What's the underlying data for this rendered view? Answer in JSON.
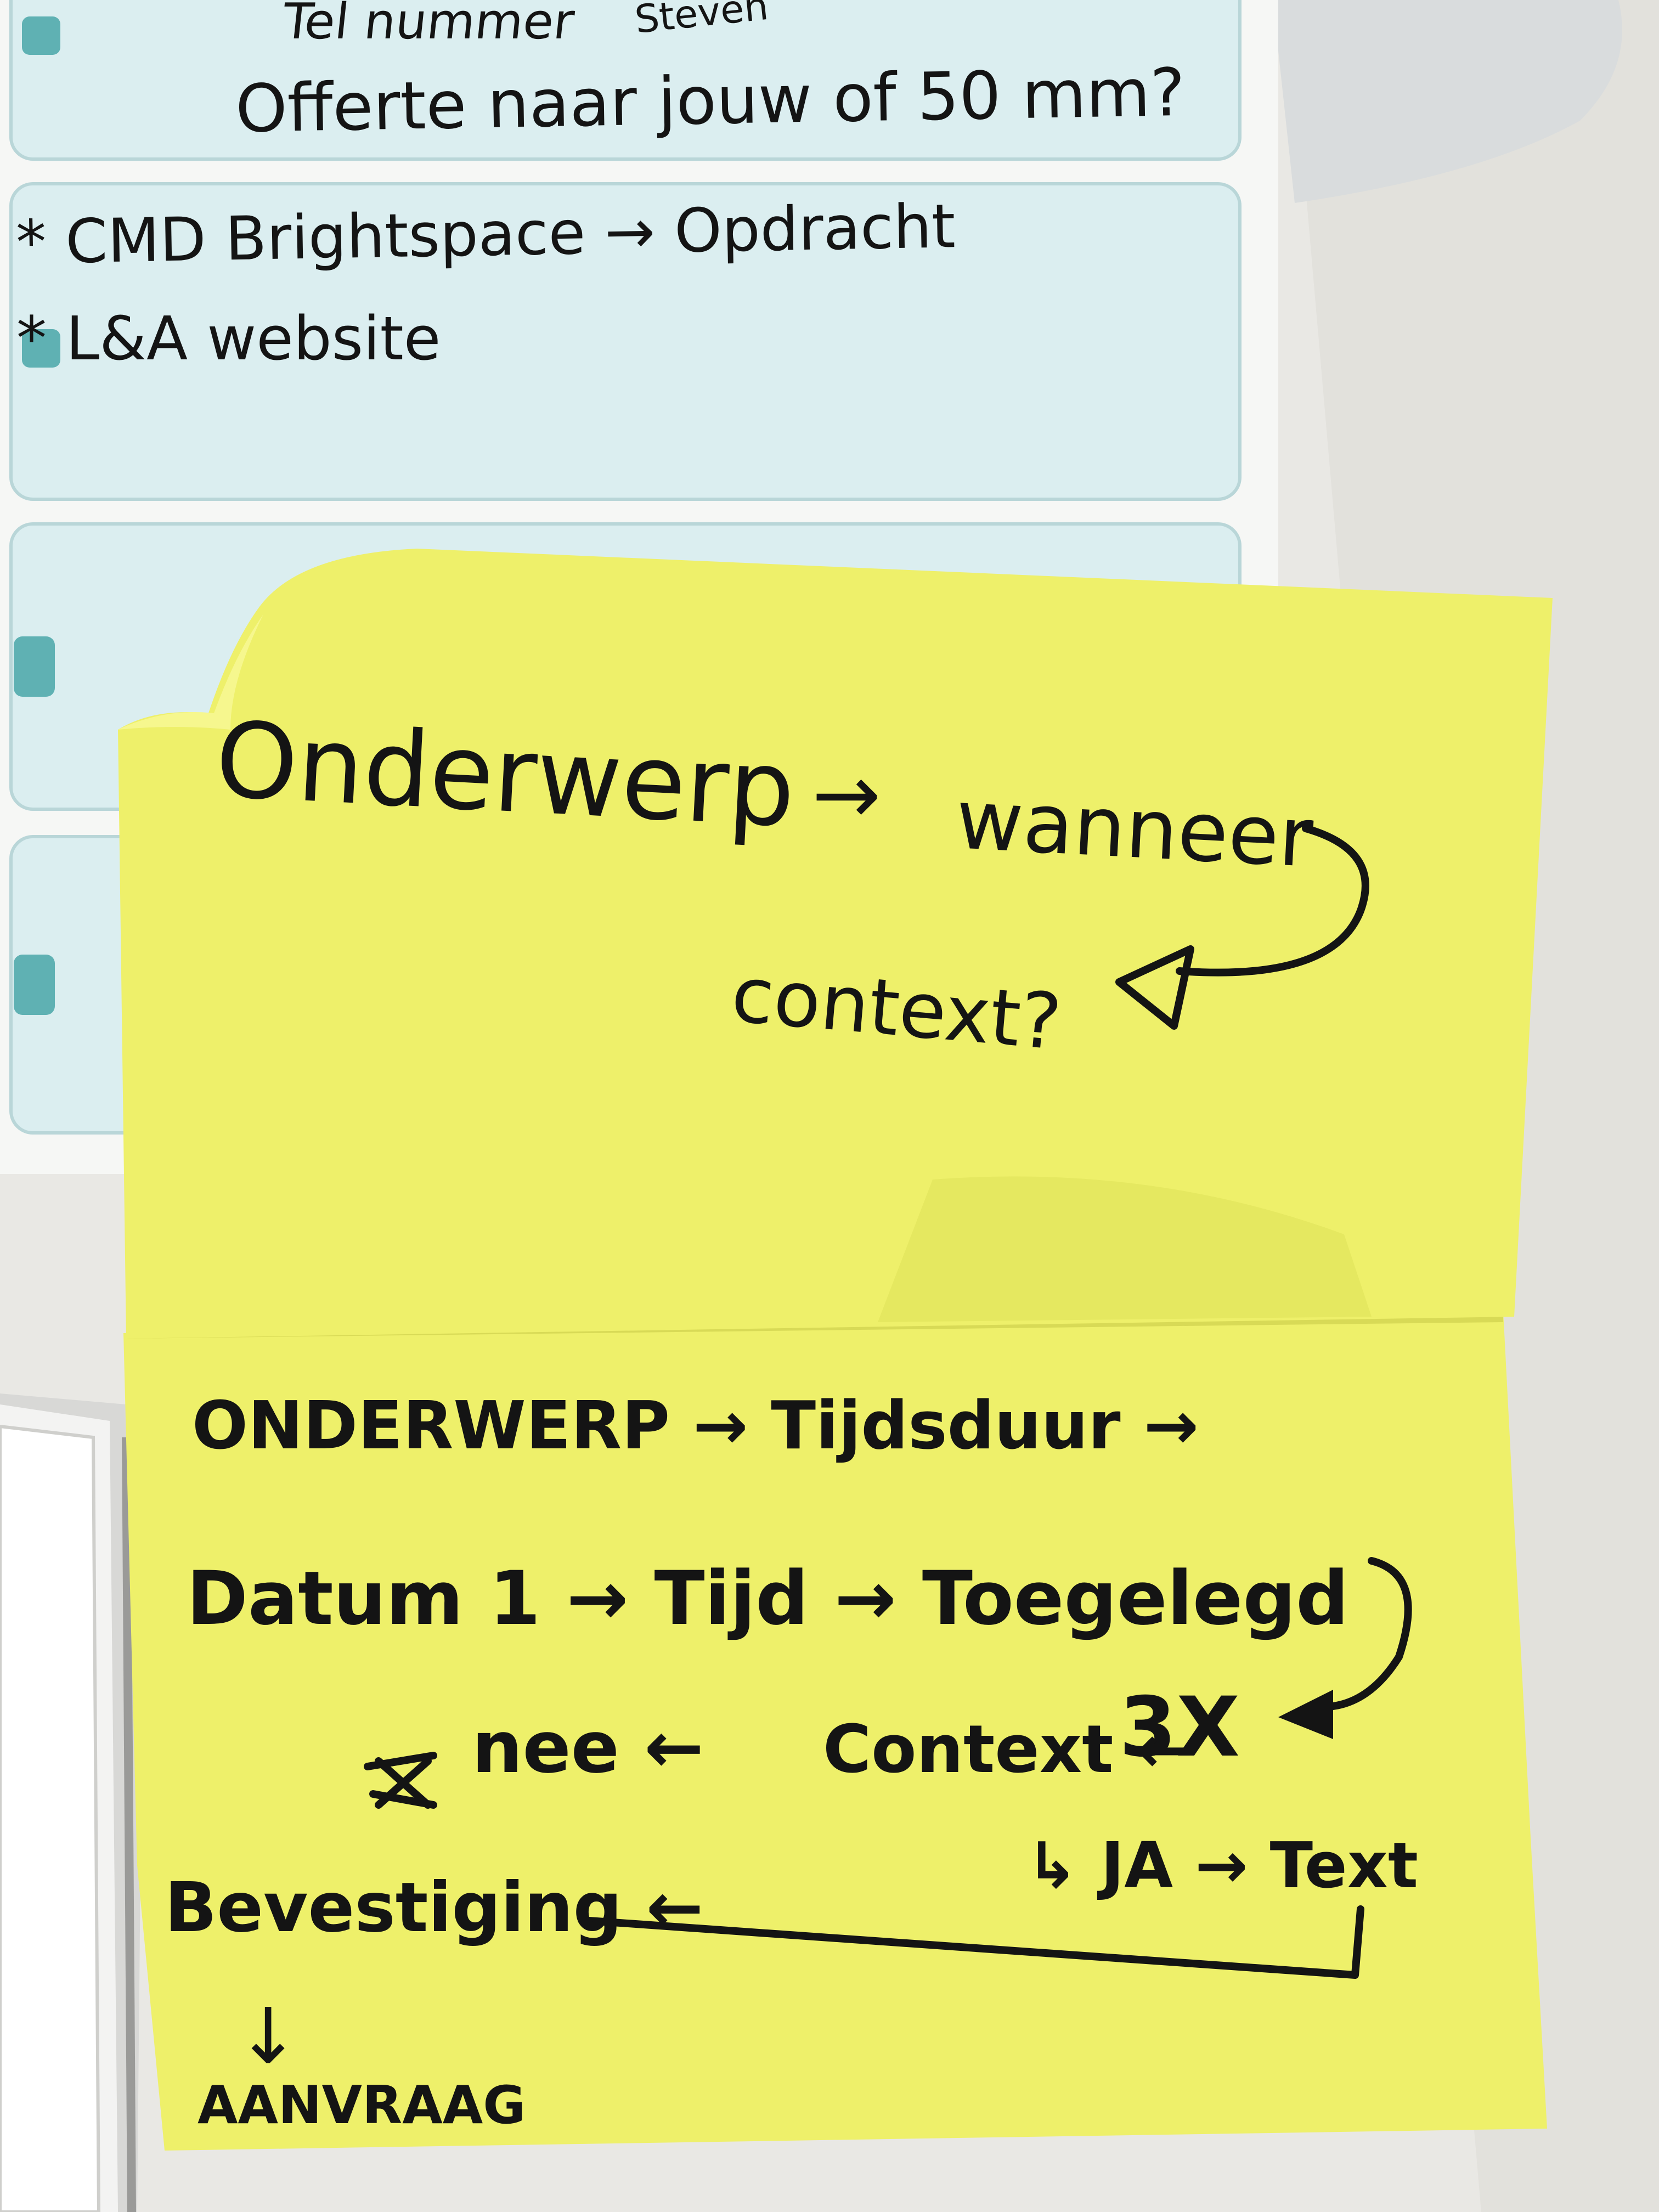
{
  "planner": {
    "rows": [
      {
        "lines": [
          "Tel nummer",
          "Offerte naar jouw of 50 mm?"
        ]
      },
      {
        "lines": [
          "* CMD Brightspace → Opdracht",
          "* L&A website"
        ]
      },
      {
        "lines": []
      },
      {
        "lines": []
      }
    ],
    "top_annotation": "Steven"
  },
  "sticky_top": {
    "onderwerp": "Onderwerp",
    "arrow1": "→",
    "wanneer": "wanneer",
    "context": "context?"
  },
  "sticky_bottom": {
    "row1": "ONDERWERP → Tijdsduur →",
    "row2": "Datum 1 → Tijd → Toegelegd",
    "row3_left": "nee ←",
    "row3_mid": "Context ←",
    "row3_right": "3X",
    "row4": "↳ JA → Text",
    "bevestiging": "Bevestiging ←",
    "down_arrow": "↓",
    "aanvraag": "AANVRAAG"
  },
  "colors": {
    "paper": "#f6f7f5",
    "planner_cell": "#dbeef0",
    "teal_tab": "#5fb1b3",
    "sticky": "#eef06a",
    "ink": "#141414"
  }
}
